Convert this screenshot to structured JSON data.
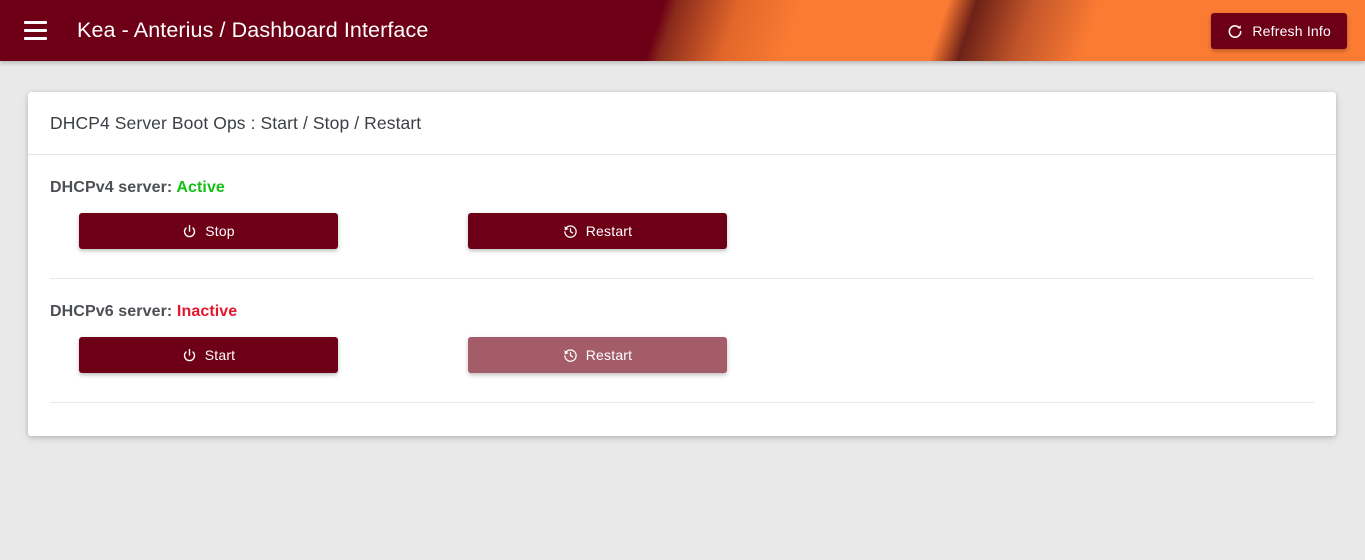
{
  "header": {
    "menu_icon": "hamburger-menu-icon",
    "title": "Kea - Anterius / Dashboard Interface",
    "refresh_button": {
      "label": "Refresh Info",
      "icon": "refresh-icon"
    },
    "colors": {
      "primary": "#6d0016",
      "accent_orange": "#fb7b33"
    }
  },
  "card": {
    "title": "DHCP4 Server Boot Ops : Start / Stop / Restart",
    "servers": [
      {
        "name_label": "DHCPv4 server:",
        "status": "Active",
        "status_color": "#13c013",
        "buttons": [
          {
            "label": "Stop",
            "icon": "power-icon",
            "disabled": false
          },
          {
            "label": "Restart",
            "icon": "history-icon",
            "disabled": false
          }
        ]
      },
      {
        "name_label": "DHCPv6 server:",
        "status": "Inactive",
        "status_color": "#e5172f",
        "buttons": [
          {
            "label": "Start",
            "icon": "power-icon",
            "disabled": false
          },
          {
            "label": "Restart",
            "icon": "history-icon",
            "disabled": true
          }
        ]
      }
    ]
  }
}
